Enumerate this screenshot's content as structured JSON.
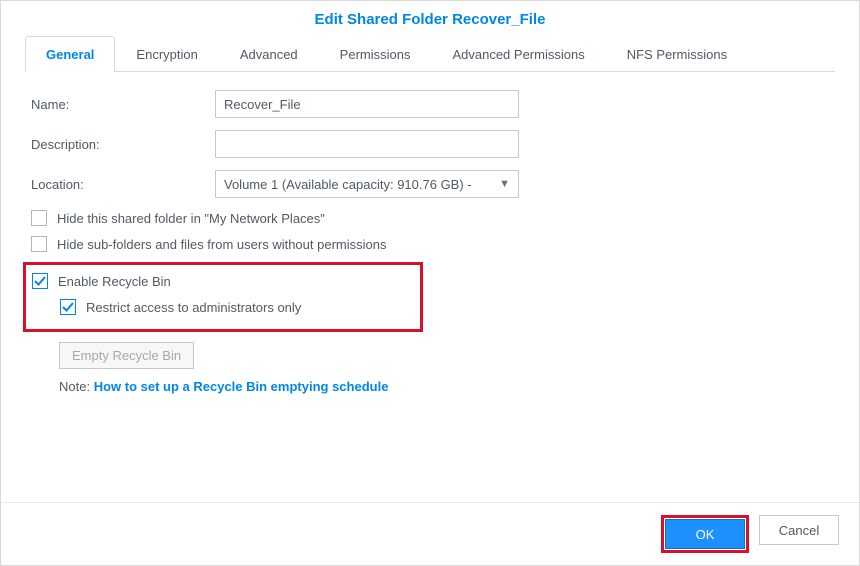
{
  "title": "Edit Shared Folder Recover_File",
  "tabs": {
    "general": "General",
    "encryption": "Encryption",
    "advanced": "Advanced",
    "permissions": "Permissions",
    "adv_permissions": "Advanced Permissions",
    "nfs": "NFS Permissions"
  },
  "fields": {
    "name_label": "Name:",
    "name_value": "Recover_File",
    "description_label": "Description:",
    "description_value": "",
    "location_label": "Location:",
    "location_value": "Volume 1 (Available capacity: 910.76 GB) -"
  },
  "options": {
    "hide_network": "Hide this shared folder in \"My Network Places\"",
    "hide_subfolders": "Hide sub-folders and files from users without permissions",
    "enable_recycle": "Enable Recycle Bin",
    "restrict_admin": "Restrict access to administrators only",
    "empty_btn": "Empty Recycle Bin",
    "note_prefix": "Note: ",
    "note_link": "How to set up a Recycle Bin emptying schedule"
  },
  "buttons": {
    "ok": "OK",
    "cancel": "Cancel"
  }
}
